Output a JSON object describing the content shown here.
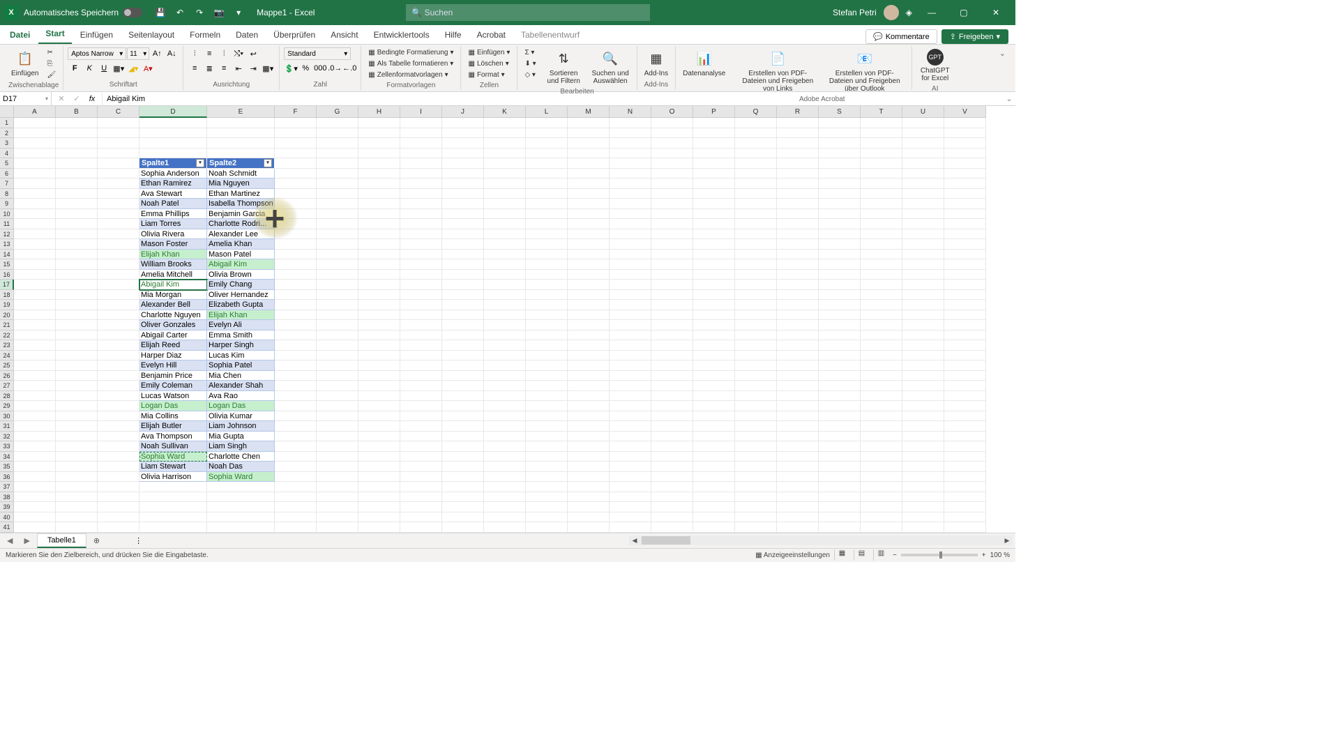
{
  "titlebar": {
    "autosave_label": "Automatisches Speichern",
    "filename": "Mappe1 - Excel",
    "search_placeholder": "Suchen",
    "user_name": "Stefan Petri"
  },
  "tabs": {
    "file": "Datei",
    "items": [
      "Start",
      "Einfügen",
      "Seitenlayout",
      "Formeln",
      "Daten",
      "Überprüfen",
      "Ansicht",
      "Entwicklertools",
      "Hilfe",
      "Acrobat",
      "Tabellenentwurf"
    ],
    "active_index": 0,
    "comments": "Kommentare",
    "share": "Freigeben"
  },
  "ribbon": {
    "paste": "Einfügen",
    "clipboard_label": "Zwischenablage",
    "font_name": "Aptos Narrow",
    "font_size": "11",
    "font_label": "Schriftart",
    "alignment_label": "Ausrichtung",
    "number_format": "Standard",
    "number_label": "Zahl",
    "cond_format": "Bedingte Formatierung",
    "as_table": "Als Tabelle formatieren",
    "cell_styles": "Zellenformatvorlagen",
    "styles_label": "Formatvorlagen",
    "insert": "Einfügen",
    "delete": "Löschen",
    "format": "Format",
    "cells_label": "Zellen",
    "sort_filter": "Sortieren und Filtern",
    "find_select": "Suchen und Auswählen",
    "addins": "Add-Ins",
    "editing_label": "Bearbeiten",
    "addins_label": "Add-Ins",
    "data_analysis": "Datenanalyse",
    "pdf_create": "Erstellen von PDF-Dateien und Freigeben von Links",
    "pdf_outlook": "Erstellen von PDF-Dateien und Freigeben über Outlook",
    "acrobat_label": "Adobe Acrobat",
    "chatgpt": "ChatGPT for Excel",
    "ai_label": "AI"
  },
  "formula_bar": {
    "name_box": "D17",
    "formula": "Abigail Kim"
  },
  "columns": [
    "A",
    "B",
    "C",
    "D",
    "E",
    "F",
    "G",
    "H",
    "I",
    "J",
    "K",
    "L",
    "M",
    "N",
    "O",
    "P",
    "Q",
    "R",
    "S",
    "T",
    "U",
    "V"
  ],
  "col_widths": {
    "default": 60,
    "D": 97,
    "E": 97
  },
  "selected_col": "D",
  "row_count": 41,
  "selected_row": 17,
  "table": {
    "headers": [
      "Spalte1",
      "Spalte2"
    ],
    "header_row": 5,
    "rows": [
      {
        "d": "Sophia Anderson",
        "e": "Noah Schmidt"
      },
      {
        "d": "Ethan Ramirez",
        "e": "Mia Nguyen"
      },
      {
        "d": "Ava Stewart",
        "e": "Ethan Martinez"
      },
      {
        "d": "Noah Patel",
        "e": "Isabella Thompson"
      },
      {
        "d": "Emma Phillips",
        "e": "Benjamin Garcia"
      },
      {
        "d": "Liam Torres",
        "e": "Charlotte Rodri..."
      },
      {
        "d": "Olivia Rivera",
        "e": "Alexander Lee"
      },
      {
        "d": "Mason Foster",
        "e": "Amelia Khan"
      },
      {
        "d": "Elijah Khan",
        "e": "Mason Patel",
        "d_hl": true
      },
      {
        "d": "William Brooks",
        "e": "Abigail Kim",
        "e_hl": true
      },
      {
        "d": "Amelia Mitchell",
        "e": "Olivia Brown"
      },
      {
        "d": "Abigail Kim",
        "e": "Emily Chang",
        "d_hl": true,
        "active": true
      },
      {
        "d": "Mia Morgan",
        "e": "Oliver Hernandez"
      },
      {
        "d": "Alexander Bell",
        "e": "Elizabeth Gupta"
      },
      {
        "d": "Charlotte Nguyen",
        "e": "Elijah Khan",
        "e_hl": true
      },
      {
        "d": "Oliver Gonzales",
        "e": "Evelyn Ali"
      },
      {
        "d": "Abigail Carter",
        "e": "Emma Smith"
      },
      {
        "d": "Elijah Reed",
        "e": "Harper Singh"
      },
      {
        "d": "Harper Diaz",
        "e": "Lucas Kim"
      },
      {
        "d": "Evelyn Hill",
        "e": "Sophia Patel"
      },
      {
        "d": "Benjamin Price",
        "e": "Mia Chen"
      },
      {
        "d": "Emily Coleman",
        "e": "Alexander Shah"
      },
      {
        "d": "Lucas Watson",
        "e": "Ava Rao"
      },
      {
        "d": "Logan Das",
        "e": "Logan Das",
        "d_hl": true,
        "e_hl": true
      },
      {
        "d": "Mia Collins",
        "e": "Olivia Kumar"
      },
      {
        "d": "Elijah Butler",
        "e": "Liam Johnson"
      },
      {
        "d": "Ava Thompson",
        "e": "Mia Gupta"
      },
      {
        "d": "Noah Sullivan",
        "e": "Liam Singh"
      },
      {
        "d": "Sophia Ward",
        "e": "Charlotte Chen",
        "d_hl": true,
        "marquee": true
      },
      {
        "d": "Liam Stewart",
        "e": "Noah Das"
      },
      {
        "d": "Olivia Harrison",
        "e": "Sophia Ward",
        "e_hl": true
      }
    ]
  },
  "sheet_tab": {
    "name": "Tabelle1"
  },
  "statusbar": {
    "message": "Markieren Sie den Zielbereich, und drücken Sie die Eingabetaste.",
    "display_settings": "Anzeigeeinstellungen",
    "zoom": "100 %"
  }
}
